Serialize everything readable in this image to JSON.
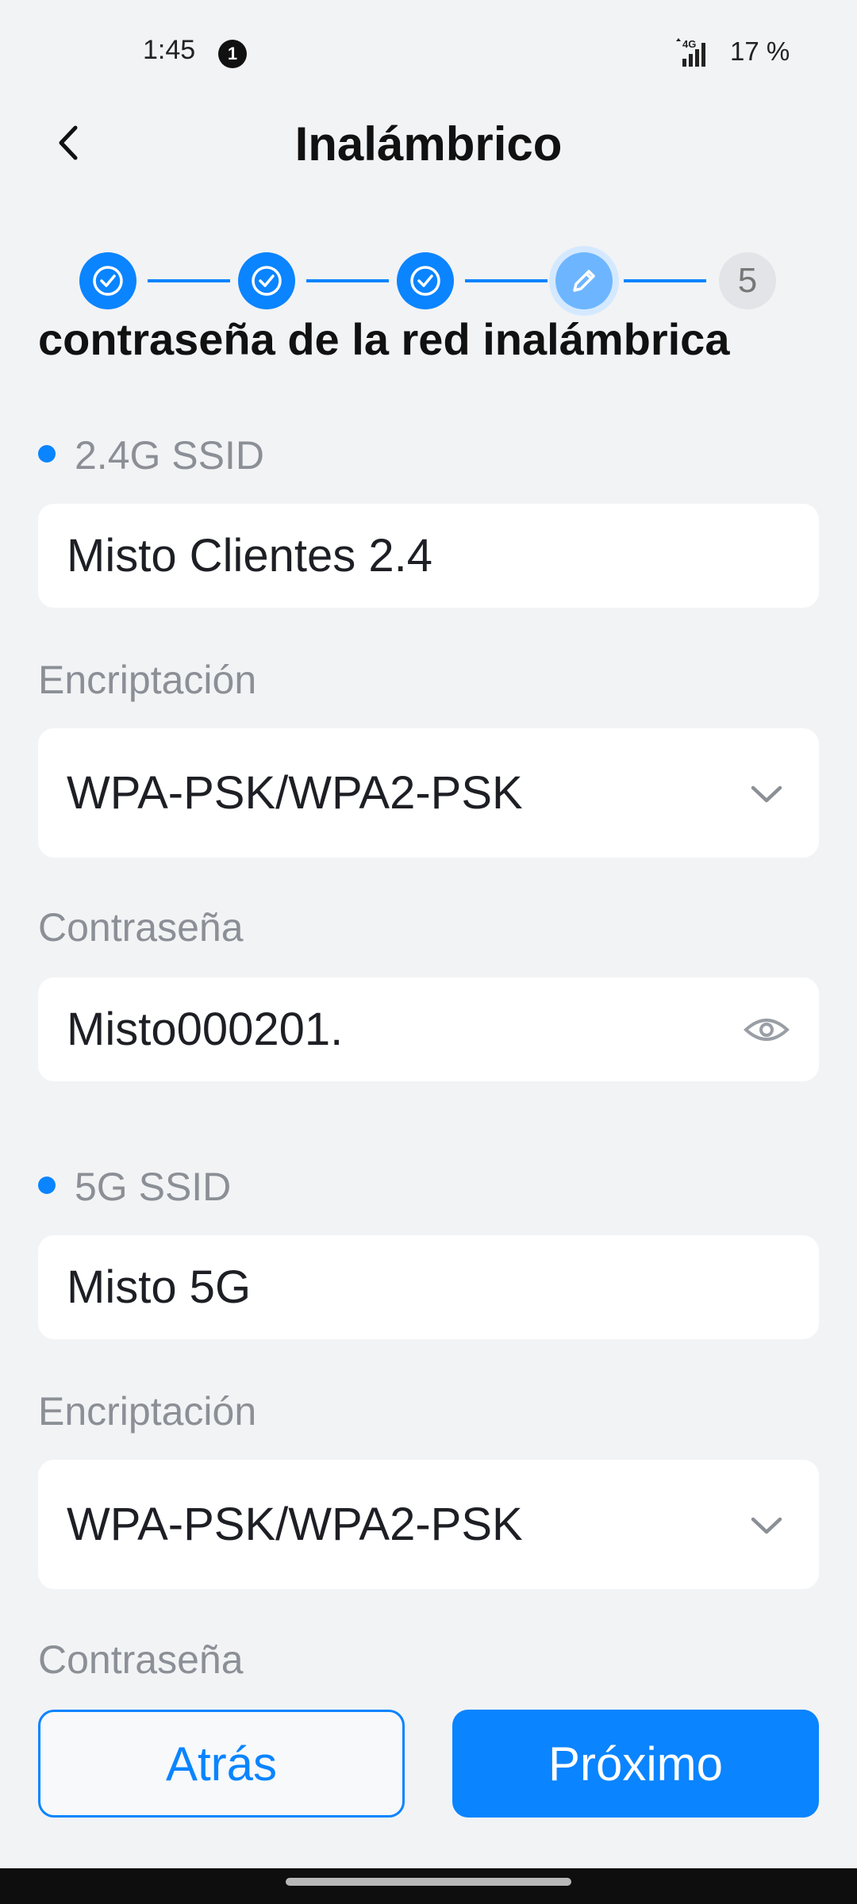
{
  "status_bar": {
    "time": "1:45",
    "notification_count": "1",
    "network": "4G",
    "battery": "17 %"
  },
  "header": {
    "title": "Inalámbrico"
  },
  "stepper": {
    "total_steps": 5,
    "current_step": 4,
    "pending_label": "5"
  },
  "section_title": "contraseña de la red inalámbrica",
  "band_24": {
    "ssid_label": "2.4G SSID",
    "ssid_value": "Misto Clientes 2.4",
    "encryption_label": "Encriptación",
    "encryption_value": "WPA-PSK/WPA2-PSK",
    "password_label": "Contraseña",
    "password_value": "Misto000201."
  },
  "band_5": {
    "ssid_label": "5G SSID",
    "ssid_value": "Misto 5G",
    "encryption_label": "Encriptación",
    "encryption_value": "WPA-PSK/WPA2-PSK",
    "password_label": "Contraseña"
  },
  "buttons": {
    "back": "Atrás",
    "next": "Próximo"
  },
  "icons": [
    "back-arrow-icon",
    "check-icon",
    "pencil-icon",
    "chevron-down-icon",
    "eye-icon",
    "signal-icon"
  ],
  "colors": {
    "accent": "#0a84ff",
    "background": "#f2f3f5",
    "label": "#8b8f96"
  }
}
